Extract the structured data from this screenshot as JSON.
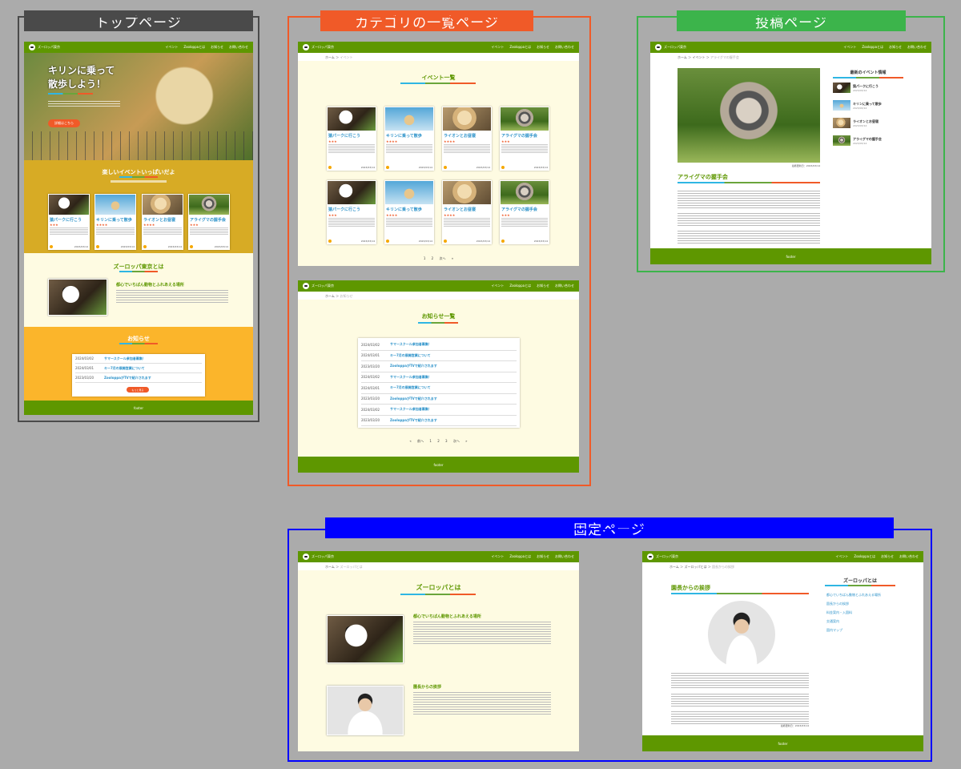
{
  "labels": {
    "top": "トップページ",
    "category": "カテゴリの一覧ページ",
    "post": "投稿ページ",
    "fixed": "固定ページ"
  },
  "colors": {
    "top": "#4a4a4a",
    "category": "#f05a28",
    "post": "#3cb44b",
    "fixed": "#0000ff",
    "header": "#5e9700"
  },
  "site": {
    "logo": "ズーロッパ東京",
    "nav": [
      "イベント",
      "Zooloppaとは",
      "お知らせ",
      "お問い合わせ"
    ],
    "footer": "footer"
  },
  "crumb": {
    "home": "ホーム",
    "sep": "＞"
  },
  "top": {
    "hero_title_1": "キリンに乗って",
    "hero_title_2": "散歩しよう！",
    "hero_button": "詳細はこちら",
    "events_title": "楽しいイベントいっぱいだよ",
    "about_title": "ズーロッパ東京とは",
    "about_sub": "都心でいちばん動物とふれあえる場所",
    "news_title": "お知らせ",
    "news_button": "もっと見る",
    "news": [
      {
        "date": "2024/03/02",
        "title": "サマースクール参加者募集！"
      },
      {
        "date": "2024/03/01",
        "title": "キー7月の展開営業について"
      },
      {
        "date": "2023/03/20",
        "title": "ZooloppaがTVで紹介されます"
      }
    ]
  },
  "cards": [
    {
      "title": "猿パークに行こう",
      "stars": "★★★",
      "date": "2023/03/14",
      "pic": "pic-panda"
    },
    {
      "title": "キリンに乗って散歩",
      "stars": "★★★★",
      "date": "2023/03/14",
      "pic": "pic-sky"
    },
    {
      "title": "ライオンとお昼寝",
      "stars": "★★★★",
      "date": "2023/03/14",
      "pic": "pic-lion"
    },
    {
      "title": "アライグマの握手会",
      "stars": "★★★",
      "date": "2023/03/14",
      "pic": "pic-raccoon"
    }
  ],
  "category": {
    "crumb_current": "イベント",
    "events_title": "イベント一覧",
    "pagination": "1 2 次へ »",
    "news_crumb": "お知らせ",
    "news_title": "お知らせ一覧",
    "news_pagination": "« 前へ 1 2 3 次へ »",
    "news": [
      {
        "date": "2024/03/02",
        "title": "サマースクール参加者募集！"
      },
      {
        "date": "2024/03/01",
        "title": "キー7月の展開営業について"
      },
      {
        "date": "2023/03/20",
        "title": "ZooloppaがTVで紹介されます"
      },
      {
        "date": "2024/03/02",
        "title": "サマースクール参加者募集！"
      },
      {
        "date": "2024/03/01",
        "title": "キー7月の展開営業について"
      },
      {
        "date": "2023/03/20",
        "title": "ZooloppaがTVで紹介されます"
      },
      {
        "date": "2024/03/02",
        "title": "サマースクール参加者募集！"
      },
      {
        "date": "2023/03/20",
        "title": "ZooloppaがTVで紹介されます"
      }
    ]
  },
  "post": {
    "crumb_mid": "イベント",
    "crumb_current": "アライグマの握手会",
    "title": "アライグマの握手会",
    "meta": "最終更新日：2023/03/14",
    "side_title": "最新のイベント情報",
    "side": [
      {
        "title": "猿パークに行こう",
        "date": "2023/03/14",
        "pic": "pic-panda"
      },
      {
        "title": "キリンに乗って散歩",
        "date": "2023/03/14",
        "pic": "pic-sky"
      },
      {
        "title": "ライオンとお昼寝",
        "date": "2023/03/14",
        "pic": "pic-lion"
      },
      {
        "title": "アライグマの握手会",
        "date": "2023/03/14",
        "pic": "pic-raccoon"
      }
    ]
  },
  "fixed": {
    "page1": {
      "crumb_current": "ズーロッパとは",
      "title": "ズーロッパとは",
      "sec1": "都心でいちばん動物とふれあえる場所",
      "sec2": "園長からの挨拶"
    },
    "page2": {
      "crumb_mid": "ズーロッパとは",
      "crumb_current": "園長からの挨拶",
      "title": "園長からの挨拶",
      "meta": "最終更新日：2023/03/14",
      "side_title": "ズーロッパとは",
      "side_links": [
        "都心でいちばん動物とふれあえる場所",
        "園長からの挨拶",
        "料金案内・入園料",
        "交通案内",
        "園内マップ"
      ]
    }
  }
}
